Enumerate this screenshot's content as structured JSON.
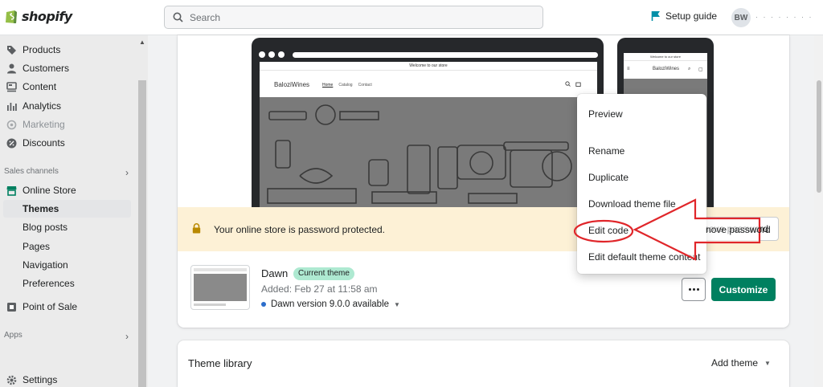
{
  "app": {
    "logo_text": "shopify"
  },
  "topbar": {
    "search_placeholder": "Search",
    "setup_guide": "Setup guide",
    "avatar_initials": "BW",
    "avatar_name": "· · · · · · · ·"
  },
  "sidebar": {
    "items": [
      {
        "label": "Products",
        "icon": "tag-icon"
      },
      {
        "label": "Customers",
        "icon": "person-icon"
      },
      {
        "label": "Content",
        "icon": "content-icon"
      },
      {
        "label": "Analytics",
        "icon": "analytics-icon"
      },
      {
        "label": "Marketing",
        "icon": "marketing-icon"
      },
      {
        "label": "Discounts",
        "icon": "discount-icon"
      }
    ],
    "sales_channels_label": "Sales channels",
    "online_store": "Online Store",
    "online_store_sub": [
      "Themes",
      "Blog posts",
      "Pages",
      "Navigation",
      "Preferences"
    ],
    "point_of_sale": "Point of Sale",
    "apps_label": "Apps",
    "settings": "Settings"
  },
  "preview": {
    "announcement": "Welcome to our store",
    "brand": "BaloziWines",
    "nav": [
      "Home",
      "Catalog",
      "Contact"
    ]
  },
  "banner": {
    "text": "Your online store is password protected.",
    "button_label": "nove password"
  },
  "current_theme": {
    "name": "Dawn",
    "badge": "Current theme",
    "added": "Added: Feb 27 at 11:58 am",
    "version": "Dawn version 9.0.0 available",
    "customize_label": "Customize"
  },
  "menu": {
    "items": [
      "Preview",
      "Rename",
      "Duplicate",
      "Download theme file",
      "Edit code",
      "Edit default theme content"
    ]
  },
  "library": {
    "title": "Theme library",
    "add_theme": "Add theme"
  },
  "colors": {
    "accent_green": "#008060",
    "banner_bg": "#fdf1d6",
    "badge_bg": "#aee9d1",
    "annotation_red": "#e0262a"
  }
}
